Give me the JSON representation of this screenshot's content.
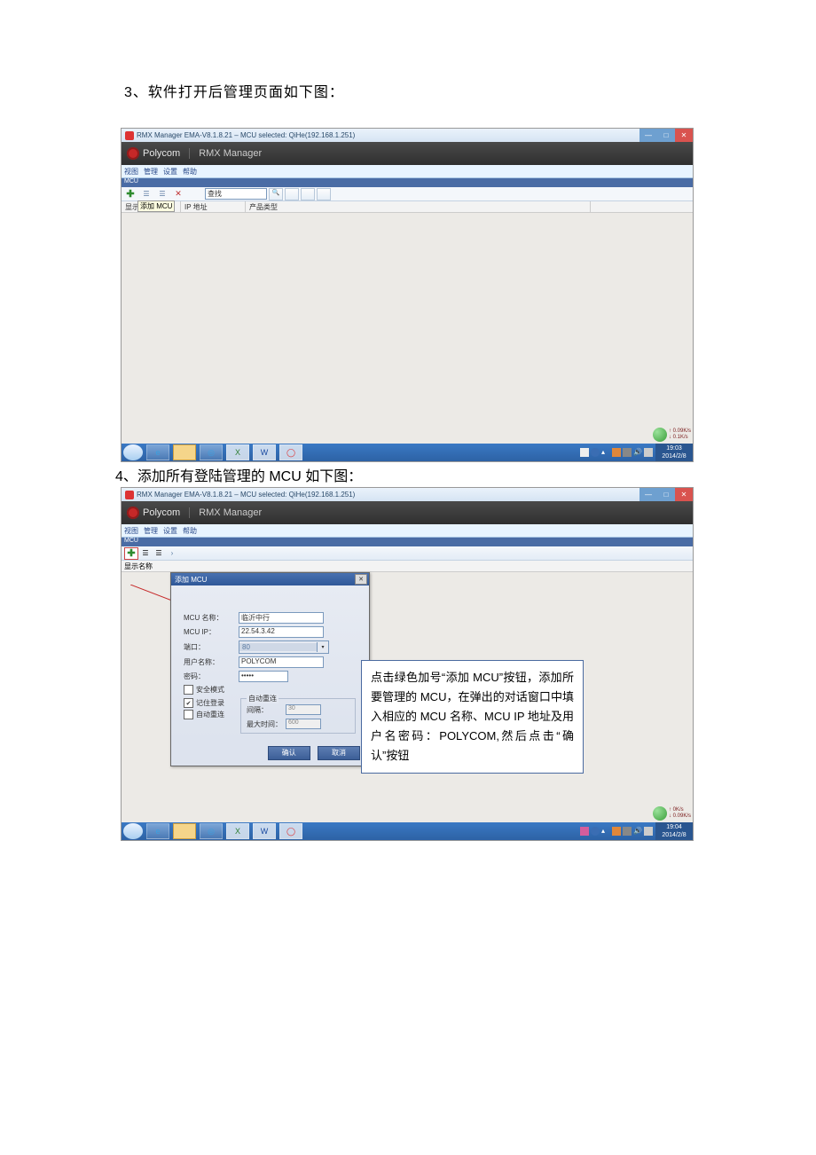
{
  "caption1": "3、软件打开后管理页面如下图：",
  "caption2": "4、添加所有登陆管理的 MCU 如下图：",
  "shot1": {
    "title": "RMX Manager EMA-V8.1.8.21 – MCU selected: QiHe(192.168.1.251)",
    "brand": "Polycom",
    "brand_sub": "RMX Manager",
    "menu": [
      "视图",
      "管理",
      "设置",
      "帮助"
    ],
    "panel_title": "MCU",
    "tooltip": "添加 MCU",
    "search_placeholder": "查找",
    "cols": {
      "c1": "显示",
      "c2": "IP 地址",
      "c3": "产品类型"
    },
    "net_up": "0.09K/s",
    "net_down": "0.1K/s",
    "clock_time": "19:03",
    "clock_date": "2014/2/8"
  },
  "shot2": {
    "title": "RMX Manager EMA-V8.1.8.21 – MCU selected: QiHe(192.168.1.251)",
    "brand": "Polycom",
    "brand_sub": "RMX Manager",
    "menu": [
      "视图",
      "管理",
      "设置",
      "帮助"
    ],
    "panel_title": "MCU",
    "col1": "显示名称",
    "dialog": {
      "title": "添加 MCU",
      "lbl_name": "MCU 名称：",
      "val_name": "临沂中行",
      "lbl_ip": "MCU IP：",
      "val_ip": "22.54.3.42",
      "lbl_port": "端口：",
      "val_port": "80",
      "lbl_user": "用户名称：",
      "val_user": "POLYCOM",
      "lbl_pwd": "密码：",
      "val_pwd": "•••••",
      "chk_secure": "安全模式",
      "chk_remember": "记住登录",
      "chk_autoreconn": "自动重连",
      "fs_legend": "自动重连",
      "lbl_interval": "间隔：",
      "val_interval": "30",
      "lbl_maxtime": "最大时间：",
      "val_maxtime": "600",
      "btn_ok": "确认",
      "btn_cancel": "取消"
    },
    "callout": "点击绿色加号“添加 MCU”按钮，添加所要管理的 MCU，在弹出的对话窗口中填入相应的 MCU 名称、MCU IP 地址及用户名密码：POLYCOM,然后点击“确认”按钮",
    "net_up": "0K/s",
    "net_down": "0.09K/s",
    "clock_time": "19:04",
    "clock_date": "2014/2/8"
  }
}
